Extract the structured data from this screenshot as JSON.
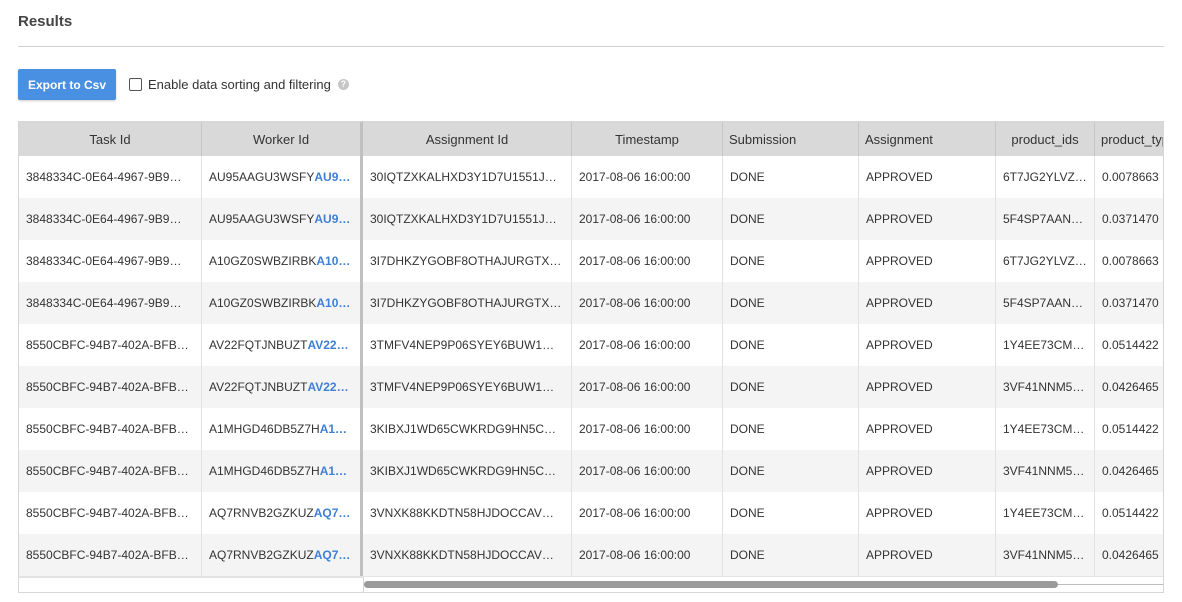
{
  "page": {
    "title": "Results"
  },
  "toolbar": {
    "export_label": "Export to Csv",
    "sort_filter_label": "Enable data sorting and filtering",
    "help_glyph": "?"
  },
  "table": {
    "columns": [
      "Task Id",
      "Worker Id",
      "Assignment Id",
      "Timestamp",
      "Submission",
      "Assignment",
      "product_ids",
      "product_typ"
    ],
    "rows": [
      {
        "task": "3848334C-0E64-4967-9B9…",
        "worker": "AU95AAGU3WSFY",
        "worker_link": "AU9…",
        "assignment": "30IQTZXKALHXD3Y1D7U1551J…",
        "timestamp": "2017-08-06 16:00:00",
        "submission": "DONE",
        "status": "APPROVED",
        "product_ids": "6T7JG2YLVZ…",
        "product_type": "0.0078663"
      },
      {
        "task": "3848334C-0E64-4967-9B9…",
        "worker": "AU95AAGU3WSFY",
        "worker_link": "AU9…",
        "assignment": "30IQTZXKALHXD3Y1D7U1551J…",
        "timestamp": "2017-08-06 16:00:00",
        "submission": "DONE",
        "status": "APPROVED",
        "product_ids": "5F4SP7AAN…",
        "product_type": "0.0371470"
      },
      {
        "task": "3848334C-0E64-4967-9B9…",
        "worker": "A10GZ0SWBZIRBK",
        "worker_link": "A10…",
        "assignment": "3I7DHKZYGOBF8OTHAJURGTX…",
        "timestamp": "2017-08-06 16:00:00",
        "submission": "DONE",
        "status": "APPROVED",
        "product_ids": "6T7JG2YLVZ…",
        "product_type": "0.0078663"
      },
      {
        "task": "3848334C-0E64-4967-9B9…",
        "worker": "A10GZ0SWBZIRBK",
        "worker_link": "A10…",
        "assignment": "3I7DHKZYGOBF8OTHAJURGTX…",
        "timestamp": "2017-08-06 16:00:00",
        "submission": "DONE",
        "status": "APPROVED",
        "product_ids": "5F4SP7AAN…",
        "product_type": "0.0371470"
      },
      {
        "task": "8550CBFC-94B7-402A-BFB…",
        "worker": "AV22FQTJNBUZT",
        "worker_link": "AV22…",
        "assignment": "3TMFV4NEP9P06SYEY6BUW1…",
        "timestamp": "2017-08-06 16:00:00",
        "submission": "DONE",
        "status": "APPROVED",
        "product_ids": "1Y4EE73CM…",
        "product_type": "0.0514422"
      },
      {
        "task": "8550CBFC-94B7-402A-BFB…",
        "worker": "AV22FQTJNBUZT",
        "worker_link": "AV22…",
        "assignment": "3TMFV4NEP9P06SYEY6BUW1…",
        "timestamp": "2017-08-06 16:00:00",
        "submission": "DONE",
        "status": "APPROVED",
        "product_ids": "3VF41NNM5…",
        "product_type": "0.0426465"
      },
      {
        "task": "8550CBFC-94B7-402A-BFB…",
        "worker": "A1MHGD46DB5Z7H",
        "worker_link": "A1…",
        "assignment": "3KIBXJ1WD65CWKRDG9HN5C…",
        "timestamp": "2017-08-06 16:00:00",
        "submission": "DONE",
        "status": "APPROVED",
        "product_ids": "1Y4EE73CM…",
        "product_type": "0.0514422"
      },
      {
        "task": "8550CBFC-94B7-402A-BFB…",
        "worker": "A1MHGD46DB5Z7H",
        "worker_link": "A1…",
        "assignment": "3KIBXJ1WD65CWKRDG9HN5C…",
        "timestamp": "2017-08-06 16:00:00",
        "submission": "DONE",
        "status": "APPROVED",
        "product_ids": "3VF41NNM5…",
        "product_type": "0.0426465"
      },
      {
        "task": "8550CBFC-94B7-402A-BFB…",
        "worker": "AQ7RNVB2GZKUZ",
        "worker_link": "AQ7…",
        "assignment": "3VNXK88KKDTN58HJDOCCAV…",
        "timestamp": "2017-08-06 16:00:00",
        "submission": "DONE",
        "status": "APPROVED",
        "product_ids": "1Y4EE73CM…",
        "product_type": "0.0514422"
      },
      {
        "task": "8550CBFC-94B7-402A-BFB…",
        "worker": "AQ7RNVB2GZKUZ",
        "worker_link": "AQ7…",
        "assignment": "3VNXK88KKDTN58HJDOCCAV…",
        "timestamp": "2017-08-06 16:00:00",
        "submission": "DONE",
        "status": "APPROVED",
        "product_ids": "3VF41NNM5…",
        "product_type": "0.0426465"
      }
    ]
  },
  "colors": {
    "accent": "#4a90e2",
    "link": "#3f7fd6",
    "header_bg": "#d9d9d9",
    "row_alt": "#f4f4f4"
  }
}
